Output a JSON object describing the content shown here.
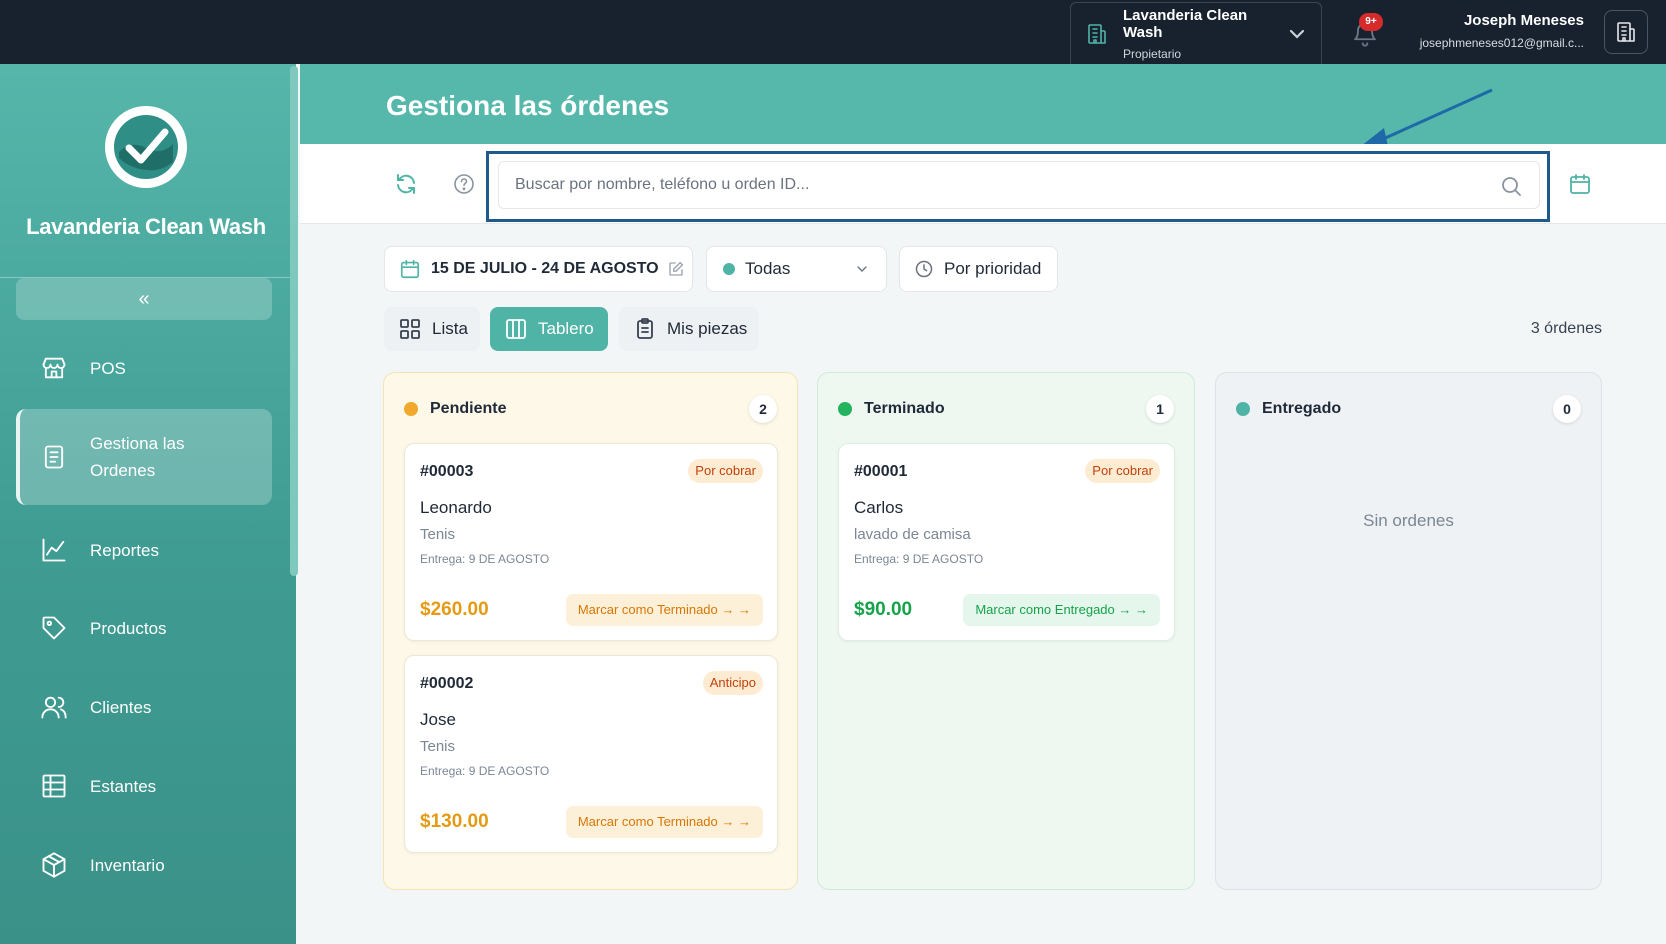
{
  "topbar": {
    "org_name": "Lavanderia Clean Wash",
    "org_role": "Propietario",
    "notif_badge": "9+",
    "user_name": "Joseph Meneses",
    "user_email": "josephmeneses012@gmail.c..."
  },
  "sidebar": {
    "brand": "Lavanderia Clean Wash",
    "collapse": "«",
    "items": [
      {
        "label": "POS",
        "icon": "store-icon"
      },
      {
        "label": "Gestiona las Ordenes",
        "icon": "document-icon"
      },
      {
        "label": "Reportes",
        "icon": "chart-line-icon"
      },
      {
        "label": "Productos",
        "icon": "tag-icon"
      },
      {
        "label": "Clientes",
        "icon": "users-icon"
      },
      {
        "label": "Estantes",
        "icon": "table-icon"
      },
      {
        "label": "Inventario",
        "icon": "box-icon"
      }
    ]
  },
  "page": {
    "title": "Gestiona las órdenes",
    "search_placeholder": "Buscar por nombre, teléfono u orden ID..."
  },
  "filters": {
    "date_range": "15 DE JULIO - 24 DE AGOSTO",
    "status": "Todas",
    "sort": "Por prioridad"
  },
  "views": {
    "list": "Lista",
    "board": "Tablero",
    "pieces": "Mis piezas",
    "count": "3 órdenes"
  },
  "columns": {
    "pending": {
      "title": "Pendiente",
      "count": "2",
      "color": "#f0a92c",
      "cards": [
        {
          "id": "#00003",
          "badge": "Por cobrar",
          "name": "Leonardo",
          "item": "Tenis",
          "date": "Entrega: 9 DE AGOSTO",
          "price": "$260.00",
          "action": "Marcar como Terminado → →"
        },
        {
          "id": "#00002",
          "badge": "Anticipo",
          "name": "Jose",
          "item": "Tenis",
          "date": "Entrega: 9 DE AGOSTO",
          "price": "$130.00",
          "action": "Marcar como Terminado → →"
        }
      ]
    },
    "done": {
      "title": "Terminado",
      "count": "1",
      "color": "#22b35e",
      "cards": [
        {
          "id": "#00001",
          "badge": "Por cobrar",
          "name": "Carlos",
          "item": "lavado de camisa",
          "date": "Entrega: 9 DE AGOSTO",
          "price": "$90.00",
          "action": "Marcar como Entregado → →"
        }
      ]
    },
    "delivered": {
      "title": "Entregado",
      "count": "0",
      "color": "#4fb3a6",
      "empty": "Sin ordenes"
    }
  }
}
